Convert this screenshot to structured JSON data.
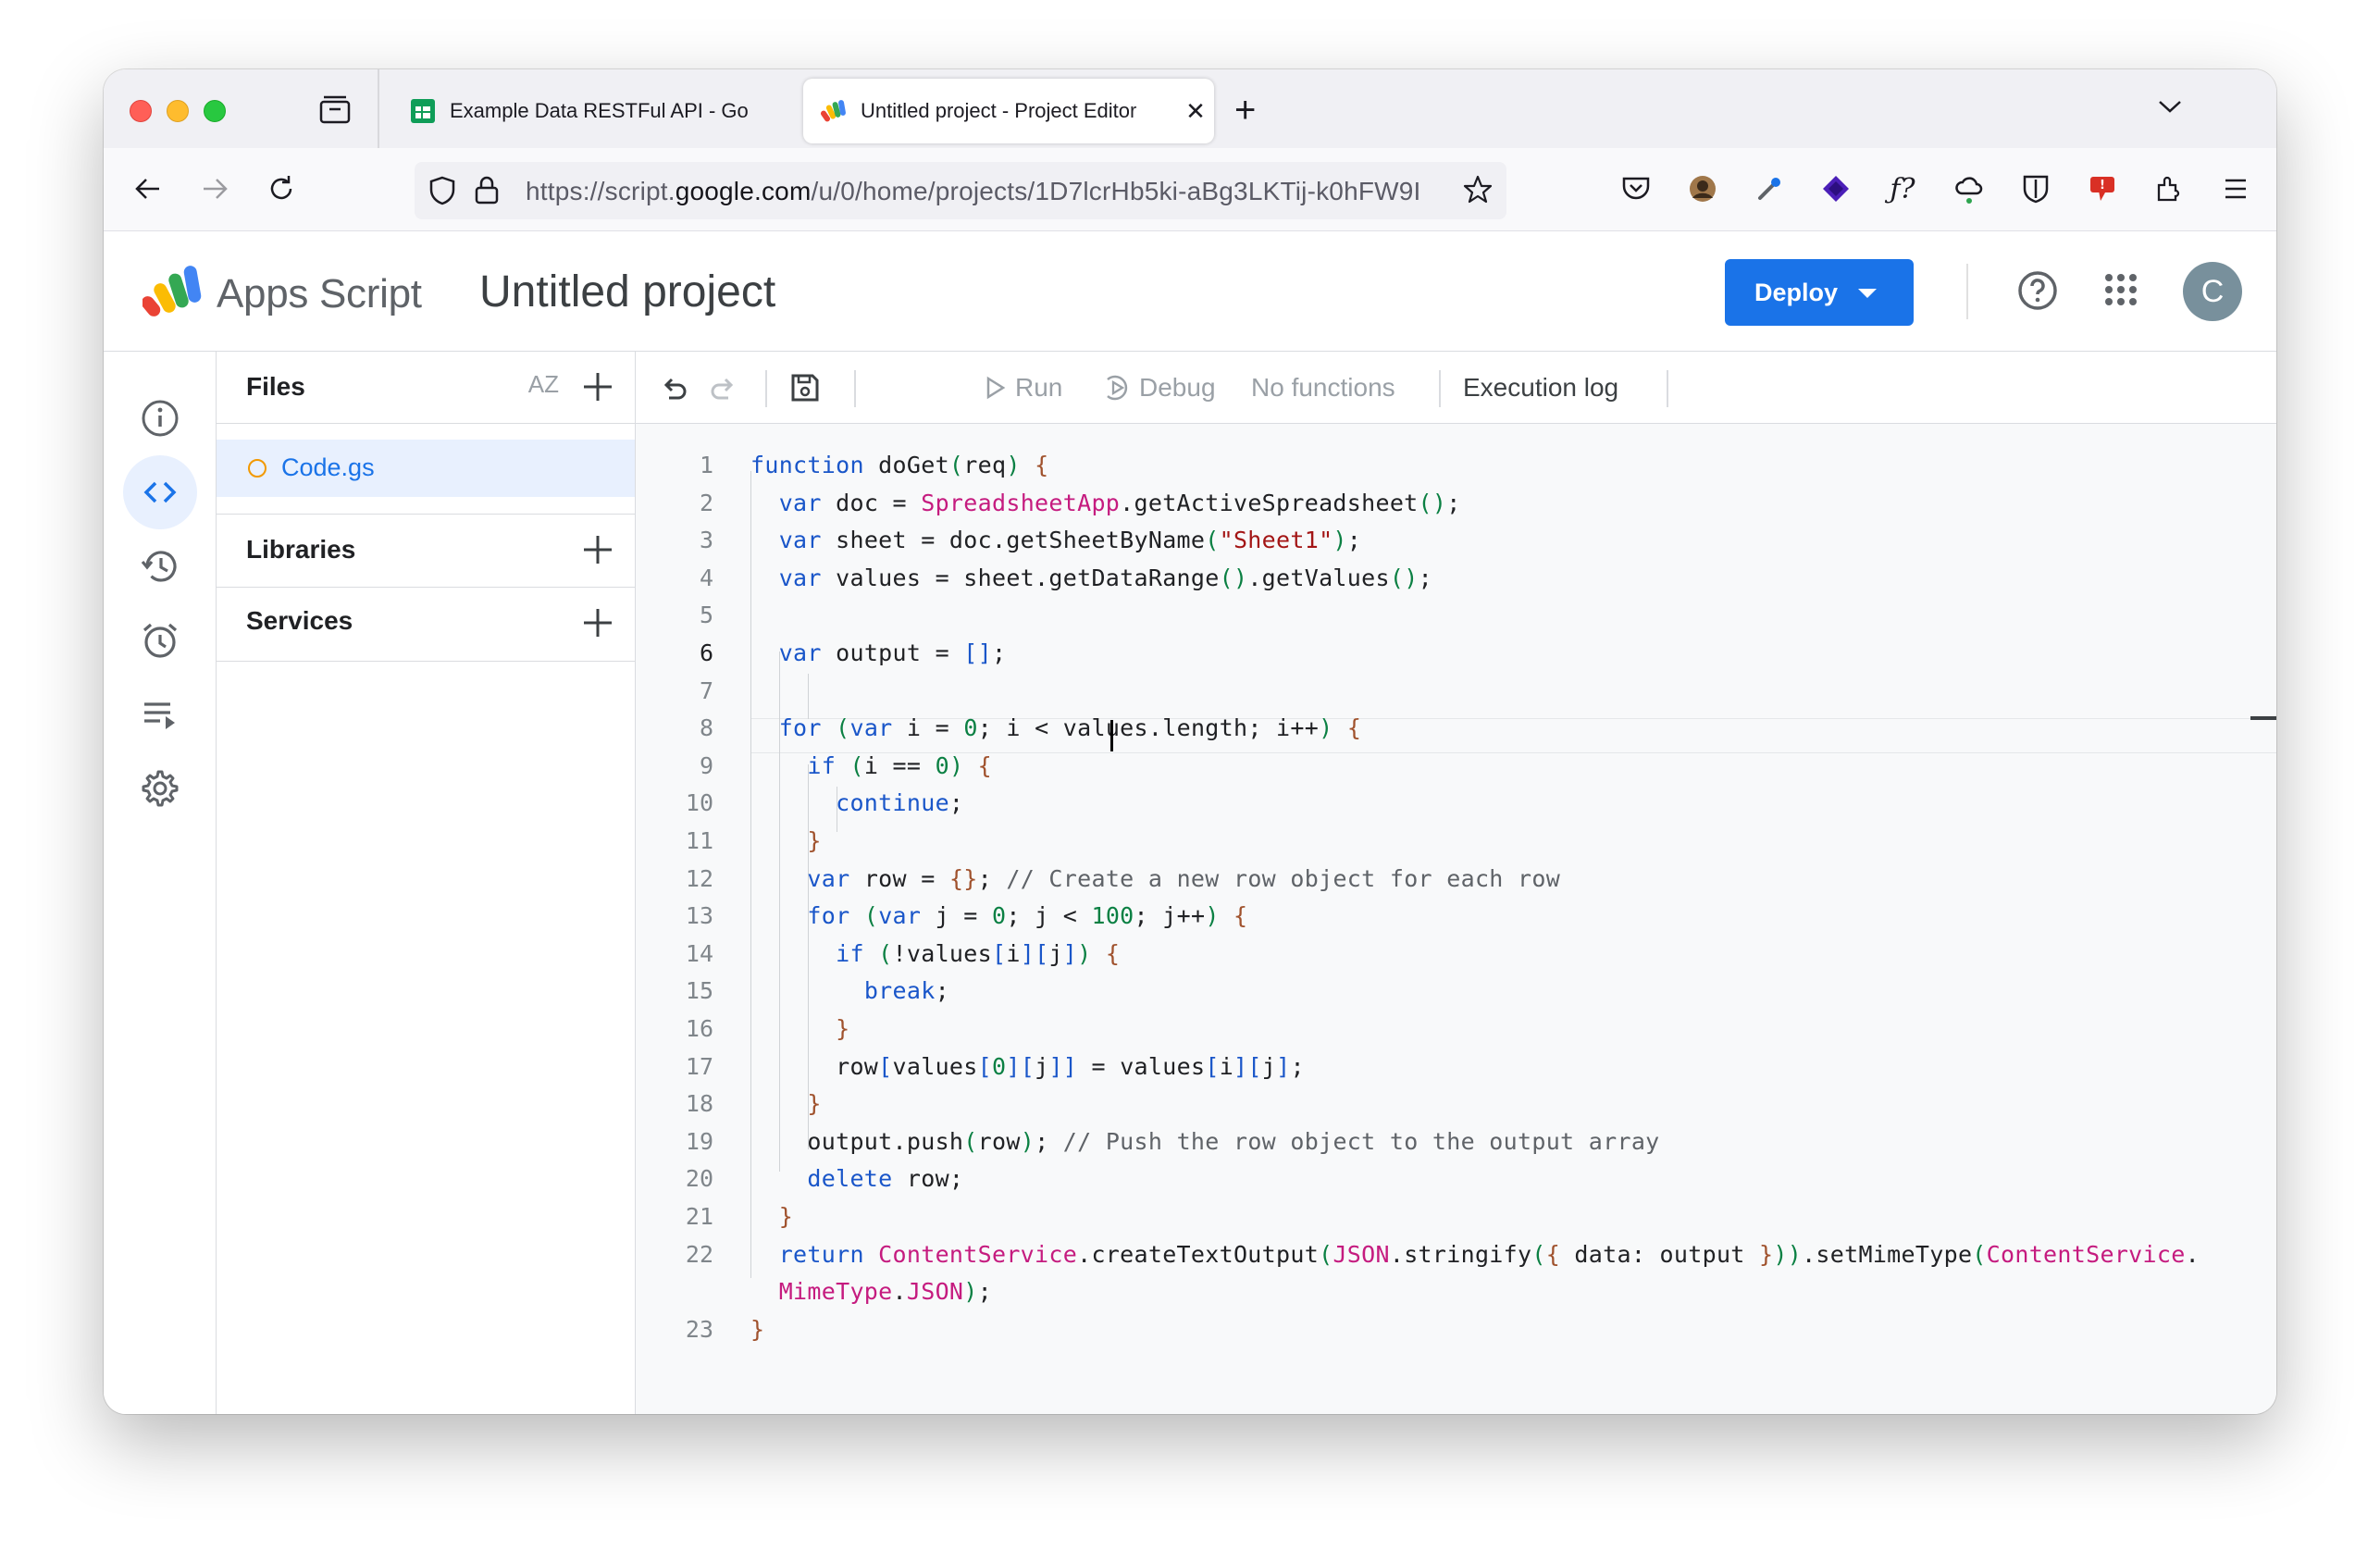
{
  "browser": {
    "tabs": [
      {
        "title": "Example Data RESTFul API - Go",
        "active": false
      },
      {
        "title": "Untitled project - Project Editor",
        "active": true
      }
    ],
    "url": {
      "prefix": "https://script.",
      "host": "google.com",
      "path": "/u/0/home/projects/1D7lcrHb5ki-aBg3LKTij-k0hFW9I"
    }
  },
  "app": {
    "brand": "Apps Script",
    "project_title": "Untitled project",
    "deploy_label": "Deploy",
    "avatar_initial": "C"
  },
  "files_panel": {
    "files_label": "Files",
    "sort_label": "AZ",
    "files": [
      {
        "name": "Code.gs"
      }
    ],
    "libraries_label": "Libraries",
    "services_label": "Services"
  },
  "toolbar": {
    "run_label": "Run",
    "debug_label": "Debug",
    "functions_label": "No functions",
    "execution_log_label": "Execution log"
  },
  "editor": {
    "current_line": 6,
    "lines": [
      "function doGet(req) {",
      "  var doc = SpreadsheetApp.getActiveSpreadsheet();",
      "  var sheet = doc.getSheetByName(\"Sheet1\");",
      "  var values = sheet.getDataRange().getValues();",
      "",
      "  var output = [];",
      "",
      "  for (var i = 0; i < values.length; i++) {",
      "    if (i == 0) {",
      "      continue;",
      "    }",
      "    var row = {}; // Create a new row object for each row",
      "    for (var j = 0; j < 100; j++) {",
      "      if (!values[i][j]) {",
      "        break;",
      "      }",
      "      row[values[0][j]] = values[i][j];",
      "    }",
      "    output.push(row); // Push the row object to the output array",
      "    delete row;",
      "  }",
      "  return ContentService.createTextOutput(JSON.stringify({ data: output })).setMimeType(ContentService.",
      "  MimeType.JSON);",
      "}"
    ],
    "line_numbers": [
      "1",
      "2",
      "3",
      "4",
      "5",
      "6",
      "7",
      "8",
      "9",
      "10",
      "11",
      "12",
      "13",
      "14",
      "15",
      "16",
      "17",
      "18",
      "19",
      "20",
      "21",
      "22",
      "",
      "23"
    ]
  },
  "colors": {
    "keyword": "#1a56c9",
    "class": "#c51b7f",
    "string": "#a31515",
    "number": "#0b8043",
    "comment": "#5f6368",
    "accent": "#1a73e8"
  }
}
